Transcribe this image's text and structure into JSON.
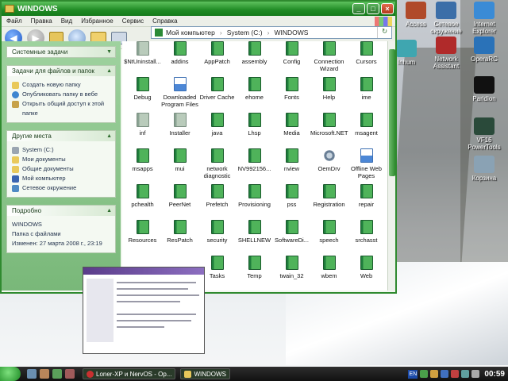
{
  "window": {
    "title": "WINDOWS",
    "menu": [
      "Файл",
      "Правка",
      "Вид",
      "Избранное",
      "Сервис",
      "Справка"
    ]
  },
  "address": {
    "segments": [
      "Мой компьютер",
      "System (C:)",
      "WINDOWS"
    ]
  },
  "taskpane": {
    "system_tasks": {
      "title": "Системные задачи"
    },
    "file_tasks": {
      "title": "Задачи для файлов и папок",
      "items": [
        "Создать новую папку",
        "Опубликовать папку в вебе",
        "Открыть общий доступ к этой папке"
      ]
    },
    "other_places": {
      "title": "Другие места",
      "items": [
        "System (C:)",
        "Мои документы",
        "Общие документы",
        "Мой компьютер",
        "Сетевое окружение"
      ]
    },
    "details": {
      "title": "Подробно",
      "name": "WINDOWS",
      "type": "Папка с файлами",
      "modified": "Изменен: 27 марта 2008 г., 23:19"
    }
  },
  "folders": [
    "$NtUninstall...",
    "addins",
    "AppPatch",
    "assembly",
    "Config",
    "Connection Wizard",
    "Cursors",
    "Debug",
    "Downloaded Program Files",
    "Driver Cache",
    "ehome",
    "Fonts",
    "Help",
    "ime",
    "inf",
    "Installer",
    "java",
    "Lhsp",
    "Media",
    "Microsoft.NET",
    "msagent",
    "msapps",
    "mui",
    "network diagnostic",
    "NV992156...",
    "nview",
    "OemDrv",
    "Offline Web Pages",
    "pchealth",
    "PeerNet",
    "Prefetch",
    "Provisioning",
    "pss",
    "Registration",
    "repair",
    "Resources",
    "ResPatch",
    "security",
    "SHELLNEW",
    "SoftwareDi...",
    "speech",
    "srchasst",
    "",
    "",
    "Tasks",
    "Temp",
    "twain_32",
    "wbem",
    "Web"
  ],
  "desktop_icons": [
    "Access",
    "Сетевое окружение",
    "Internet Explorer",
    "Inhum",
    "Network Assistant",
    "OperaRC",
    "Paridion",
    "VF16 PowerTools",
    "Корзина"
  ],
  "taskbar": {
    "tasks": [
      "Loner-XP и NervOS - Op...",
      "WINDOWS"
    ],
    "lang": "EN",
    "clock": "00:59"
  }
}
